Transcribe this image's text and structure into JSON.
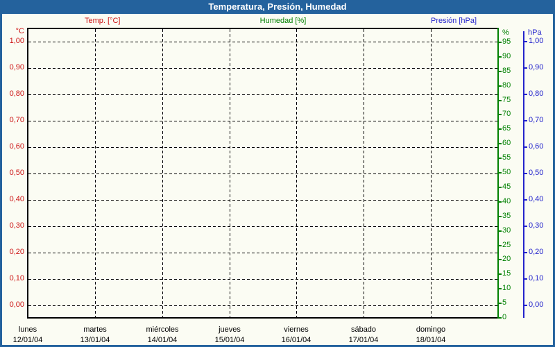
{
  "window": {
    "title": "Temperatura, Presión, Humedad"
  },
  "colors": {
    "titlebar": "#24629d",
    "border": "#24629d",
    "background": "#fbfcf3",
    "frame": "#000000",
    "grid": "#000000",
    "temp": "#cc1111",
    "humidity": "#008000",
    "pressure": "#2222cc",
    "xlabel_text": "#000000",
    "title_text": "#ffffff"
  },
  "legend": {
    "temp": "Temp. [°C]",
    "humidity": "Humedad [%]",
    "pressure": "Presión [hPa]"
  },
  "chart_data": {
    "type": "line",
    "title": "Temperatura, Presión, Humedad",
    "grid": {
      "style": "dashed",
      "h_lines": 11,
      "v_lines": 6
    },
    "series": [
      {
        "name": "Temp. [°C]",
        "axis": "left_celsius",
        "color": "#cc1111",
        "values": []
      },
      {
        "name": "Humedad [%]",
        "axis": "right_percent",
        "color": "#008000",
        "values": []
      },
      {
        "name": "Presión [hPa]",
        "axis": "right_hpa",
        "color": "#2222cc",
        "values": []
      }
    ],
    "left_axis": {
      "header": "°C",
      "color": "#cc1111",
      "min": 0,
      "max": 1,
      "step": 0.1,
      "ticks": [
        "1,00",
        "0,90",
        "0,80",
        "0,70",
        "0,60",
        "0,50",
        "0,40",
        "0,30",
        "0,20",
        "0,10",
        "0,00"
      ]
    },
    "right_percent_axis": {
      "header": "%",
      "color": "#008000",
      "min": 0,
      "max": 100,
      "step": 5,
      "ticks": [
        "95",
        "90",
        "85",
        "80",
        "75",
        "70",
        "65",
        "60",
        "55",
        "50",
        "45",
        "40",
        "35",
        "30",
        "25",
        "20",
        "15",
        "10",
        "5",
        "0"
      ]
    },
    "right_hpa_axis": {
      "header": "hPa",
      "color": "#2222cc",
      "min": 0,
      "max": 1,
      "step": 0.1,
      "ticks": [
        "1,00",
        "0,90",
        "0,80",
        "0,70",
        "0,60",
        "0,50",
        "0,40",
        "0,30",
        "0,20",
        "0,10",
        "0,00"
      ]
    },
    "x_axis": {
      "days": [
        {
          "weekday": "lunes",
          "date": "12/01/04"
        },
        {
          "weekday": "martes",
          "date": "13/01/04"
        },
        {
          "weekday": "miércoles",
          "date": "14/01/04"
        },
        {
          "weekday": "jueves",
          "date": "15/01/04"
        },
        {
          "weekday": "viernes",
          "date": "16/01/04"
        },
        {
          "weekday": "sábado",
          "date": "17/01/04"
        },
        {
          "weekday": "domingo",
          "date": "18/01/04"
        }
      ]
    }
  }
}
